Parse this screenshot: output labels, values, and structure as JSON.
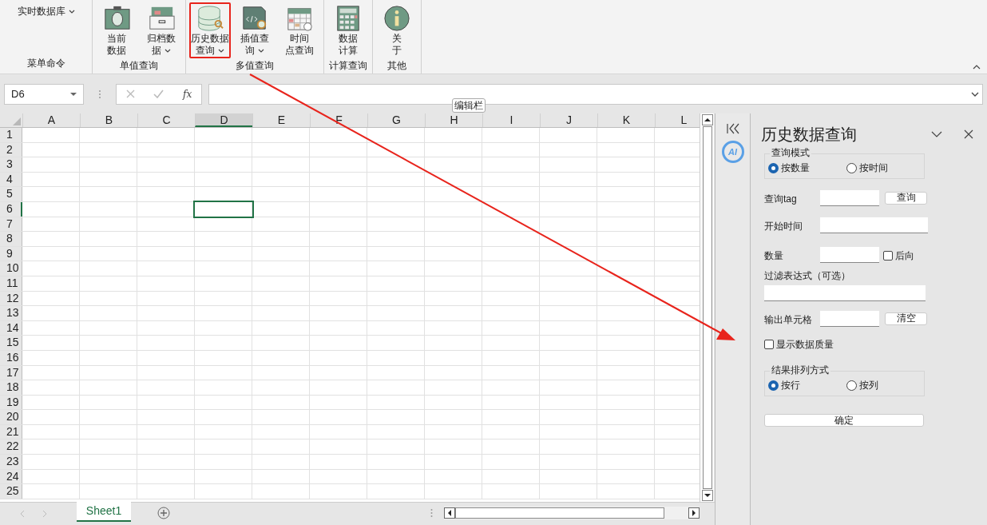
{
  "ribbon": {
    "groups": [
      {
        "label": "菜单命令",
        "menu": "实时数据库"
      },
      {
        "label": "单值查询",
        "buttons": [
          {
            "lines": [
              "当前",
              "数据"
            ],
            "dropdown": false,
            "highlighted": false
          },
          {
            "lines": [
              "归档数",
              "据"
            ],
            "dropdown": true,
            "highlighted": false
          }
        ]
      },
      {
        "label": "多值查询",
        "buttons": [
          {
            "lines": [
              "历史数据",
              "查询"
            ],
            "dropdown": true,
            "highlighted": true
          },
          {
            "lines": [
              "插值查",
              "询"
            ],
            "dropdown": true,
            "highlighted": false
          },
          {
            "lines": [
              "时间",
              "点查询"
            ],
            "dropdown": false,
            "highlighted": false
          }
        ]
      },
      {
        "label": "计算查询",
        "buttons": [
          {
            "lines": [
              "数据",
              "计算"
            ],
            "dropdown": false,
            "highlighted": false
          }
        ]
      },
      {
        "label": "其他",
        "buttons": [
          {
            "lines": [
              "关",
              "于"
            ],
            "dropdown": false,
            "highlighted": false
          }
        ]
      }
    ]
  },
  "formula_bar": {
    "name_box": "D6",
    "function_symbol": "fx",
    "tooltip": "编辑栏"
  },
  "sheet": {
    "columns": [
      {
        "label": "A",
        "selected": false
      },
      {
        "label": "B",
        "selected": false
      },
      {
        "label": "C",
        "selected": false
      },
      {
        "label": "D",
        "selected": true
      },
      {
        "label": "E",
        "selected": false
      },
      {
        "label": "F",
        "selected": false
      },
      {
        "label": "G",
        "selected": false
      },
      {
        "label": "H",
        "selected": false
      },
      {
        "label": "I",
        "selected": false
      },
      {
        "label": "J",
        "selected": false
      },
      {
        "label": "K",
        "selected": false
      },
      {
        "label": "L",
        "selected": false
      }
    ],
    "rows": [
      {
        "label": "1",
        "selected": false
      },
      {
        "label": "2",
        "selected": false
      },
      {
        "label": "3",
        "selected": false
      },
      {
        "label": "4",
        "selected": false
      },
      {
        "label": "5",
        "selected": false
      },
      {
        "label": "6",
        "selected": true
      },
      {
        "label": "7",
        "selected": false
      },
      {
        "label": "8",
        "selected": false
      },
      {
        "label": "9",
        "selected": false
      },
      {
        "label": "10",
        "selected": false
      },
      {
        "label": "11",
        "selected": false
      },
      {
        "label": "12",
        "selected": false
      },
      {
        "label": "13",
        "selected": false
      },
      {
        "label": "14",
        "selected": false
      },
      {
        "label": "15",
        "selected": false
      },
      {
        "label": "16",
        "selected": false
      },
      {
        "label": "17",
        "selected": false
      },
      {
        "label": "18",
        "selected": false
      },
      {
        "label": "19",
        "selected": false
      },
      {
        "label": "20",
        "selected": false
      },
      {
        "label": "21",
        "selected": false
      },
      {
        "label": "22",
        "selected": false
      },
      {
        "label": "23",
        "selected": false
      },
      {
        "label": "24",
        "selected": false
      },
      {
        "label": "25",
        "selected": false
      }
    ],
    "tabs": [
      {
        "label": "Sheet1",
        "selected": true
      }
    ]
  },
  "task_pane": {
    "title": "历史数据查询",
    "mode_group": {
      "legend": "查询模式",
      "options": [
        {
          "label": "按数量",
          "selected": true
        },
        {
          "label": "按时间",
          "selected": false
        }
      ]
    },
    "query_tag": {
      "label": "查询tag",
      "button": "查询"
    },
    "start_time": {
      "label": "开始时间"
    },
    "count": {
      "label": "数量",
      "checkbox": {
        "label": "后向",
        "checked": false
      }
    },
    "filter": {
      "label": "过滤表达式（可选）"
    },
    "output_cell": {
      "label": "输出单元格",
      "button": "清空"
    },
    "quality": {
      "label": "显示数据质量",
      "checked": false
    },
    "order_group": {
      "legend": "结果排列方式",
      "options": [
        {
          "label": "按行",
          "selected": true
        },
        {
          "label": "按列",
          "selected": false
        }
      ]
    },
    "confirm": "确定"
  },
  "side_strip": {
    "ai_badge": "AI"
  },
  "annotation": {
    "arrow": true
  }
}
